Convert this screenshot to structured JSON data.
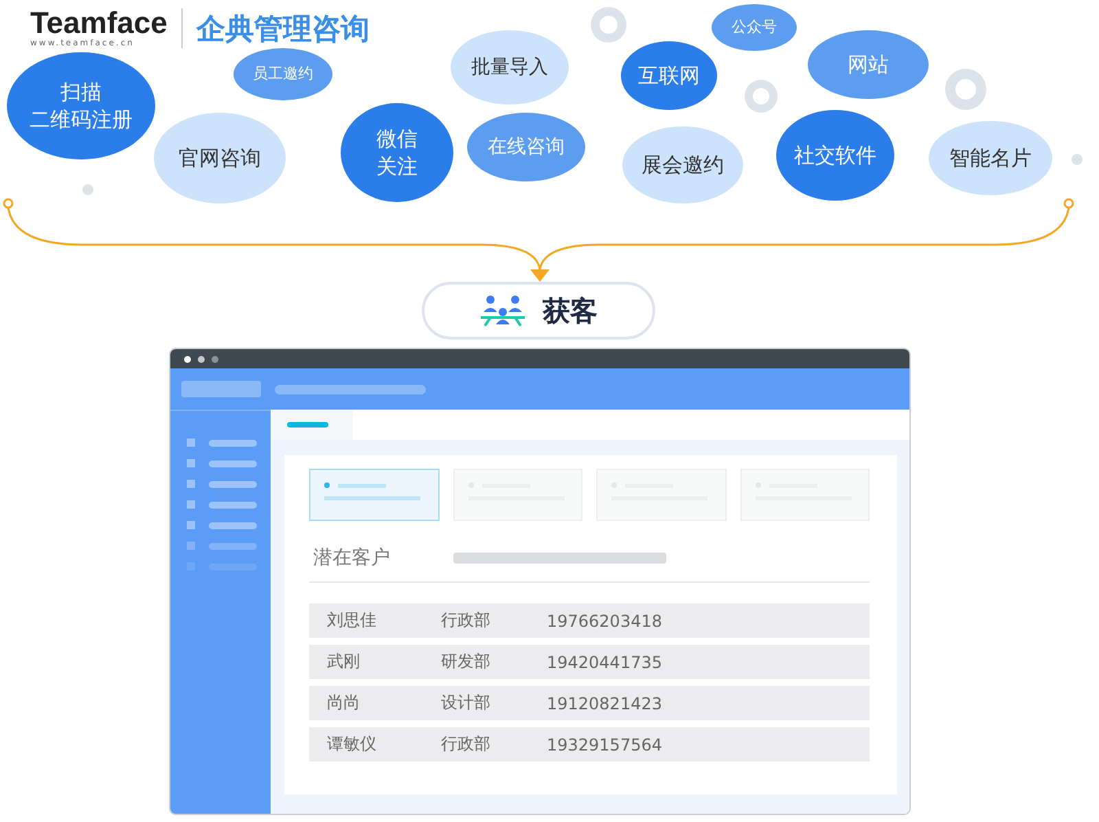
{
  "logo": {
    "name": "Teamface",
    "url": "www.teamface.cn",
    "tagline": "企典管理咨询"
  },
  "sources": [
    {
      "lines": [
        "扫描",
        "二维码注册"
      ],
      "kind": "dark"
    },
    {
      "lines": [
        "员工邀约"
      ],
      "kind": "medium"
    },
    {
      "lines": [
        "官网咨询"
      ],
      "kind": "light"
    },
    {
      "lines": [
        "微信",
        "关注"
      ],
      "kind": "dark"
    },
    {
      "lines": [
        "批量导入"
      ],
      "kind": "light"
    },
    {
      "lines": [
        "在线咨询"
      ],
      "kind": "medium"
    },
    {
      "lines": [
        "公众号"
      ],
      "kind": "medium"
    },
    {
      "lines": [
        "互联网"
      ],
      "kind": "dark"
    },
    {
      "lines": [
        "网站"
      ],
      "kind": "medium"
    },
    {
      "lines": [
        "展会邀约"
      ],
      "kind": "light"
    },
    {
      "lines": [
        "社交软件"
      ],
      "kind": "dark"
    },
    {
      "lines": [
        "智能名片"
      ],
      "kind": "light"
    }
  ],
  "hub": {
    "label": "获客"
  },
  "window": {
    "summary_cards": [
      {
        "selected": true
      },
      {
        "selected": false
      },
      {
        "selected": false
      },
      {
        "selected": false
      }
    ],
    "section_title": "潜在客户",
    "rows": [
      {
        "name": "刘思佳",
        "department": "行政部",
        "phone": "19766203418"
      },
      {
        "name": "武刚",
        "department": "研发部",
        "phone": "19420441735"
      },
      {
        "name": "尚尚",
        "department": "设计部",
        "phone": "19120821423"
      },
      {
        "name": "谭敏仪",
        "department": "行政部",
        "phone": "19329157564"
      }
    ]
  }
}
